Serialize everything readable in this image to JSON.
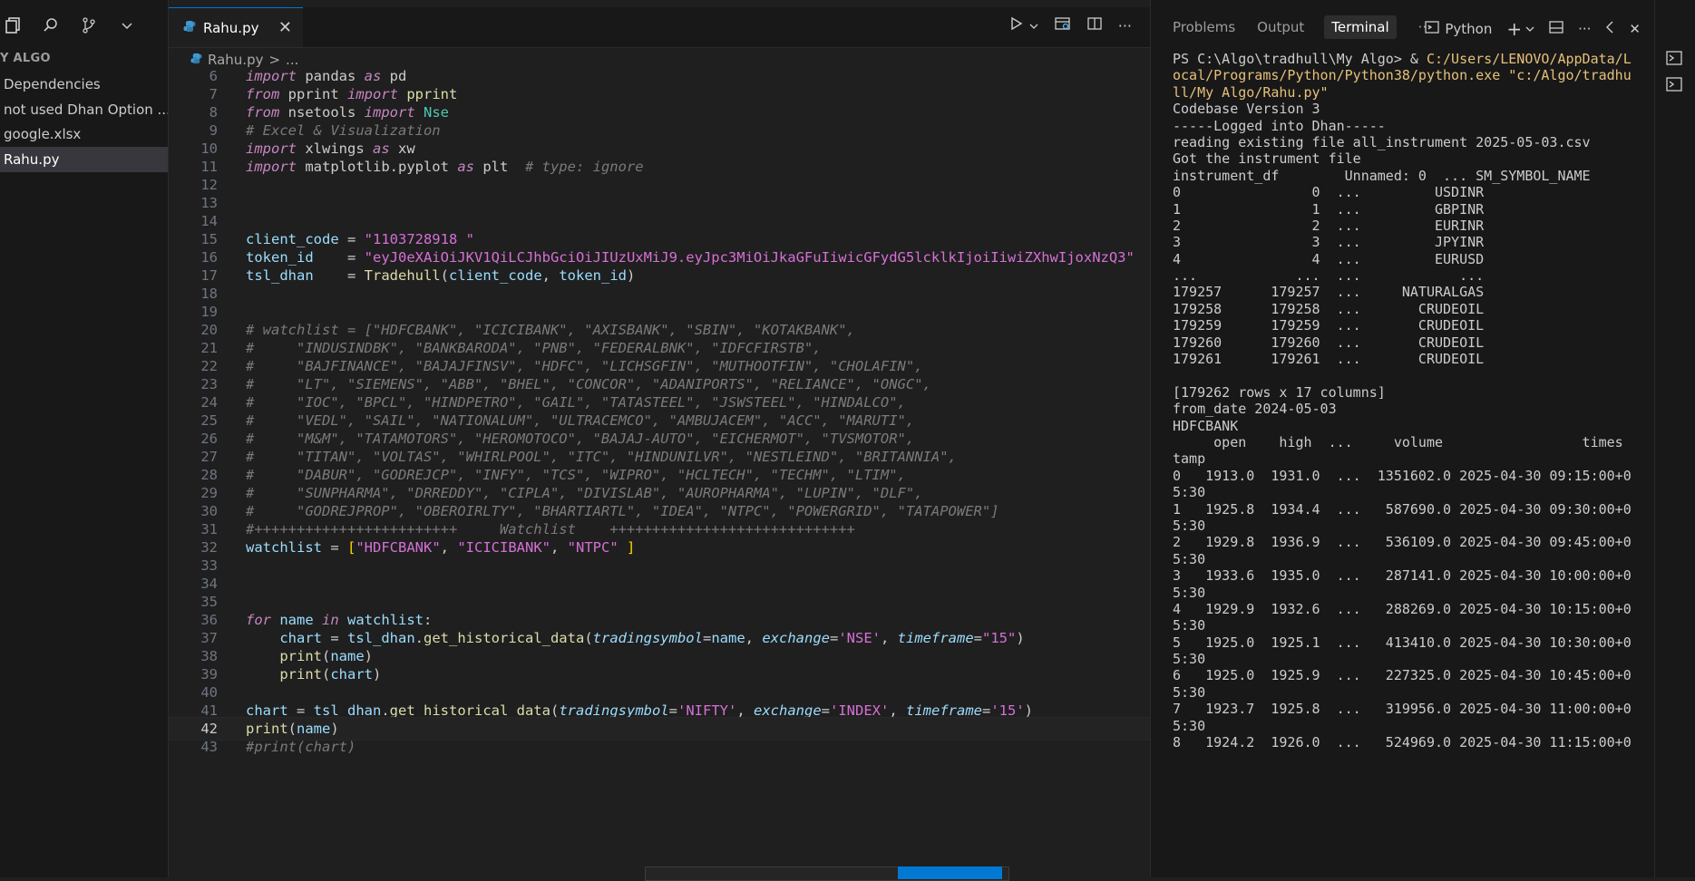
{
  "sidebar": {
    "title": "Y ALGO",
    "items": [
      {
        "label": "Dependencies",
        "active": false
      },
      {
        "label": "not used Dhan Option ...",
        "active": false
      },
      {
        "label": "google.xlsx",
        "active": false
      },
      {
        "label": "Rahu.py",
        "active": true
      }
    ]
  },
  "editor": {
    "tab_label": "Rahu.py",
    "breadcrumb_file": "Rahu.py",
    "breadcrumb_more": "...",
    "breadcrumb_sep": ">",
    "current_line": 42
  },
  "panel": {
    "tabs": [
      "Problems",
      "Output",
      "Terminal"
    ],
    "active_tab": "Terminal",
    "more": "···",
    "shell_label": "Python"
  },
  "code": [
    {
      "n": "6",
      "segs": [
        [
          "kw",
          "import"
        ],
        [
          "",
          " pandas "
        ],
        [
          "kw",
          "as"
        ],
        [
          "",
          " pd"
        ]
      ]
    },
    {
      "n": "7",
      "segs": [
        [
          "kw",
          "from"
        ],
        [
          "",
          " pprint "
        ],
        [
          "kw",
          "import"
        ],
        [
          "",
          " "
        ],
        [
          "fn",
          "pprint"
        ]
      ]
    },
    {
      "n": "8",
      "segs": [
        [
          "kw",
          "from"
        ],
        [
          "",
          " nsetools "
        ],
        [
          "kw",
          "import"
        ],
        [
          "",
          " "
        ],
        [
          "cls",
          "Nse"
        ]
      ]
    },
    {
      "n": "9",
      "segs": [
        [
          "gcm",
          "# Excel & Visualization"
        ]
      ]
    },
    {
      "n": "10",
      "segs": [
        [
          "kw",
          "import"
        ],
        [
          "",
          " xlwings "
        ],
        [
          "kw",
          "as"
        ],
        [
          "",
          " xw"
        ]
      ]
    },
    {
      "n": "11",
      "segs": [
        [
          "kw",
          "import"
        ],
        [
          "",
          " matplotlib.pyplot "
        ],
        [
          "kw",
          "as"
        ],
        [
          "",
          " plt  "
        ],
        [
          "gcm",
          "# type: ignore"
        ]
      ]
    },
    {
      "n": "12",
      "segs": []
    },
    {
      "n": "13",
      "segs": []
    },
    {
      "n": "14",
      "segs": []
    },
    {
      "n": "15",
      "segs": [
        [
          "var",
          "client_code"
        ],
        [
          "",
          " = "
        ],
        [
          "str2",
          "\"1103728918 \""
        ]
      ]
    },
    {
      "n": "16",
      "segs": [
        [
          "var",
          "token_id"
        ],
        [
          "",
          "    = "
        ],
        [
          "str2",
          "\"eyJ0eXAiOiJKV1QiLCJhbGciOiJIUzUxMiJ9.eyJpc3MiOiJkaGFuIiwicGFydG5lcklkIjoiIiwiZXhwIjoxNzQ3\""
        ]
      ]
    },
    {
      "n": "17",
      "segs": [
        [
          "var",
          "tsl_dhan"
        ],
        [
          "",
          "    = "
        ],
        [
          "fn",
          "Tradehull"
        ],
        [
          "",
          "("
        ],
        [
          "var",
          "client_code"
        ],
        [
          "",
          ", "
        ],
        [
          "var",
          "token_id"
        ],
        [
          "",
          ")"
        ]
      ]
    },
    {
      "n": "18",
      "segs": []
    },
    {
      "n": "19",
      "segs": []
    },
    {
      "n": "20",
      "segs": [
        [
          "gcm",
          "# watchlist = [\"HDFCBANK\", \"ICICIBANK\", \"AXISBANK\", \"SBIN\", \"KOTAKBANK\","
        ]
      ]
    },
    {
      "n": "21",
      "segs": [
        [
          "gcm",
          "#     \"INDUSINDBK\", \"BANKBARODA\", \"PNB\", \"FEDERALBNK\", \"IDFCFIRSTB\","
        ]
      ]
    },
    {
      "n": "22",
      "segs": [
        [
          "gcm",
          "#     \"BAJFINANCE\", \"BAJAJFINSV\", \"HDFC\", \"LICHSGFIN\", \"MUTHOOTFIN\", \"CHOLAFIN\","
        ]
      ]
    },
    {
      "n": "23",
      "segs": [
        [
          "gcm",
          "#     \"LT\", \"SIEMENS\", \"ABB\", \"BHEL\", \"CONCOR\", \"ADANIPORTS\", \"RELIANCE\", \"ONGC\","
        ]
      ]
    },
    {
      "n": "24",
      "segs": [
        [
          "gcm",
          "#     \"IOC\", \"BPCL\", \"HINDPETRO\", \"GAIL\", \"TATASTEEL\", \"JSWSTEEL\", \"HINDALCO\","
        ]
      ]
    },
    {
      "n": "25",
      "segs": [
        [
          "gcm",
          "#     \"VEDL\", \"SAIL\", \"NATIONALUM\", \"ULTRACEMCO\", \"AMBUJACEM\", \"ACC\", \"MARUTI\","
        ]
      ]
    },
    {
      "n": "26",
      "segs": [
        [
          "gcm",
          "#     \"M&M\", \"TATAMOTORS\", \"HEROMOTOCO\", \"BAJAJ-AUTO\", \"EICHERMOT\", \"TVSMOTOR\","
        ]
      ]
    },
    {
      "n": "27",
      "segs": [
        [
          "gcm",
          "#     \"TITAN\", \"VOLTAS\", \"WHIRLPOOL\", \"ITC\", \"HINDUNILVR\", \"NESTLEIND\", \"BRITANNIA\","
        ]
      ]
    },
    {
      "n": "28",
      "segs": [
        [
          "gcm",
          "#     \"DABUR\", \"GODREJCP\", \"INFY\", \"TCS\", \"WIPRO\", \"HCLTECH\", \"TECHM\", \"LTIM\","
        ]
      ]
    },
    {
      "n": "29",
      "segs": [
        [
          "gcm",
          "#     \"SUNPHARMA\", \"DRREDDY\", \"CIPLA\", \"DIVISLAB\", \"AUROPHARMA\", \"LUPIN\", \"DLF\","
        ]
      ]
    },
    {
      "n": "30",
      "segs": [
        [
          "gcm",
          "#     \"GODREJPROP\", \"OBEROIRLTY\", \"BHARTIARTL\", \"IDEA\", \"NTPC\", \"POWERGRID\", \"TATAPOWER\"]"
        ]
      ]
    },
    {
      "n": "31",
      "segs": [
        [
          "gcm",
          "#++++++++++++++++++++++++     Watchlist    +++++++++++++++++++++++++++++"
        ]
      ]
    },
    {
      "n": "32",
      "segs": [
        [
          "var",
          "watchlist"
        ],
        [
          "",
          " = "
        ],
        [
          "brk",
          "["
        ],
        [
          "str2",
          "\"HDFCBANK\""
        ],
        [
          "",
          ", "
        ],
        [
          "str2",
          "\"ICICIBANK\""
        ],
        [
          "",
          ", "
        ],
        [
          "str2",
          "\"NTPC\""
        ],
        [
          "",
          " "
        ],
        [
          "brk",
          "]"
        ]
      ]
    },
    {
      "n": "33",
      "segs": []
    },
    {
      "n": "34",
      "segs": []
    },
    {
      "n": "35",
      "segs": []
    },
    {
      "n": "36",
      "segs": [
        [
          "kw",
          "for"
        ],
        [
          "",
          " "
        ],
        [
          "var",
          "name"
        ],
        [
          "",
          " "
        ],
        [
          "kw",
          "in"
        ],
        [
          "",
          " "
        ],
        [
          "var",
          "watchlist"
        ],
        [
          "",
          ":"
        ]
      ]
    },
    {
      "n": "37",
      "segs": [
        [
          "",
          "    "
        ],
        [
          "var",
          "chart"
        ],
        [
          "",
          " = "
        ],
        [
          "var",
          "tsl_dhan"
        ],
        [
          "",
          "."
        ],
        [
          "fn",
          "get_historical_data"
        ],
        [
          "",
          "("
        ],
        [
          "prm",
          "tradingsymbol"
        ],
        [
          "",
          "="
        ],
        [
          "var",
          "name"
        ],
        [
          "",
          ", "
        ],
        [
          "prm",
          "exchange"
        ],
        [
          "",
          "="
        ],
        [
          "str2",
          "'NSE'"
        ],
        [
          "",
          ", "
        ],
        [
          "prm",
          "timeframe"
        ],
        [
          "",
          "="
        ],
        [
          "str2",
          "\"15\""
        ],
        [
          "",
          ")"
        ]
      ]
    },
    {
      "n": "38",
      "segs": [
        [
          "",
          "    "
        ],
        [
          "fn",
          "print"
        ],
        [
          "",
          "("
        ],
        [
          "var",
          "name"
        ],
        [
          "",
          ")"
        ]
      ]
    },
    {
      "n": "39",
      "segs": [
        [
          "",
          "    "
        ],
        [
          "fn",
          "print"
        ],
        [
          "",
          "("
        ],
        [
          "var",
          "chart"
        ],
        [
          "",
          ")"
        ]
      ]
    },
    {
      "n": "40",
      "segs": []
    },
    {
      "n": "41",
      "segs": [
        [
          "var",
          "chart"
        ],
        [
          "",
          " = "
        ],
        [
          "var",
          "tsl_dhan"
        ],
        [
          "",
          "."
        ],
        [
          "fn",
          "get_historical_data"
        ],
        [
          "",
          "("
        ],
        [
          "prm",
          "tradingsymbol"
        ],
        [
          "",
          "="
        ],
        [
          "str2",
          "'NIFTY'"
        ],
        [
          "",
          ", "
        ],
        [
          "prm",
          "exchange"
        ],
        [
          "",
          "="
        ],
        [
          "str2",
          "'INDEX'"
        ],
        [
          "",
          ", "
        ],
        [
          "prm",
          "timeframe"
        ],
        [
          "",
          "="
        ],
        [
          "str2",
          "'15'"
        ],
        [
          "",
          ")"
        ]
      ]
    },
    {
      "n": "42",
      "segs": [
        [
          "fn",
          "print"
        ],
        [
          "",
          "("
        ],
        [
          "var",
          "name"
        ],
        [
          "",
          ")"
        ]
      ]
    },
    {
      "n": "43",
      "segs": [
        [
          "gcm",
          "#print(chart)"
        ]
      ]
    }
  ],
  "terminal": [
    [
      [
        "",
        "PS C:\\Algo\\tradhull\\My Algo> & "
      ],
      [
        "t-y",
        "C:/Users/LENOVO/AppData/L"
      ]
    ],
    [
      [
        "t-y",
        "ocal/Programs/Python/Python38/python.exe"
      ],
      [
        "",
        " "
      ],
      [
        "t-c",
        "\"c:/Algo/tradhu"
      ]
    ],
    [
      [
        "t-c",
        "ll/My Algo/Rahu.py\""
      ]
    ],
    [
      [
        "",
        "Codebase Version 3"
      ]
    ],
    [
      [
        "",
        "-----Logged into Dhan-----"
      ]
    ],
    [
      [
        "",
        "reading existing file all_instrument 2025-05-03.csv"
      ]
    ],
    [
      [
        "",
        "Got the instrument file"
      ]
    ],
    [
      [
        "",
        "instrument_df        Unnamed: 0  ... SM_SYMBOL_NAME"
      ]
    ],
    [
      [
        "",
        "0                0  ...         USDINR"
      ]
    ],
    [
      [
        "",
        "1                1  ...         GBPINR"
      ]
    ],
    [
      [
        "",
        "2                2  ...         EURINR"
      ]
    ],
    [
      [
        "",
        "3                3  ...         JPYINR"
      ]
    ],
    [
      [
        "",
        "4                4  ...         EURUSD"
      ]
    ],
    [
      [
        "",
        "...            ...  ...            ..."
      ]
    ],
    [
      [
        "",
        "179257      179257  ...     NATURALGAS"
      ]
    ],
    [
      [
        "",
        "179258      179258  ...       CRUDEOIL"
      ]
    ],
    [
      [
        "",
        "179259      179259  ...       CRUDEOIL"
      ]
    ],
    [
      [
        "",
        "179260      179260  ...       CRUDEOIL"
      ]
    ],
    [
      [
        "",
        "179261      179261  ...       CRUDEOIL"
      ]
    ],
    [
      [
        "",
        ""
      ]
    ],
    [
      [
        "",
        "[179262 rows x 17 columns]"
      ]
    ],
    [
      [
        "",
        "from_date 2024-05-03"
      ]
    ],
    [
      [
        "",
        "HDFCBANK"
      ]
    ],
    [
      [
        "",
        "     open    high  ...     volume                 times"
      ]
    ],
    [
      [
        "",
        "tamp"
      ]
    ],
    [
      [
        "",
        "0   1913.0  1931.0  ...  1351602.0 2025-04-30 09:15:00+0"
      ]
    ],
    [
      [
        "",
        "5:30"
      ]
    ],
    [
      [
        "",
        "1   1925.8  1934.4  ...   587690.0 2025-04-30 09:30:00+0"
      ]
    ],
    [
      [
        "",
        "5:30"
      ]
    ],
    [
      [
        "",
        "2   1929.8  1936.9  ...   536109.0 2025-04-30 09:45:00+0"
      ]
    ],
    [
      [
        "",
        "5:30"
      ]
    ],
    [
      [
        "",
        "3   1933.6  1935.0  ...   287141.0 2025-04-30 10:00:00+0"
      ]
    ],
    [
      [
        "",
        "5:30"
      ]
    ],
    [
      [
        "",
        "4   1929.9  1932.6  ...   288269.0 2025-04-30 10:15:00+0"
      ]
    ],
    [
      [
        "",
        "5:30"
      ]
    ],
    [
      [
        "",
        "5   1925.0  1925.1  ...   413410.0 2025-04-30 10:30:00+0"
      ]
    ],
    [
      [
        "",
        "5:30"
      ]
    ],
    [
      [
        "",
        "6   1925.0  1925.9  ...   227325.0 2025-04-30 10:45:00+0"
      ]
    ],
    [
      [
        "",
        "5:30"
      ]
    ],
    [
      [
        "",
        "7   1923.7  1925.8  ...   319956.0 2025-04-30 11:00:00+0"
      ]
    ],
    [
      [
        "",
        "5:30"
      ]
    ],
    [
      [
        "",
        "8   1924.2  1926.0  ...   524969.0 2025-04-30 11:15:00+0"
      ]
    ]
  ]
}
